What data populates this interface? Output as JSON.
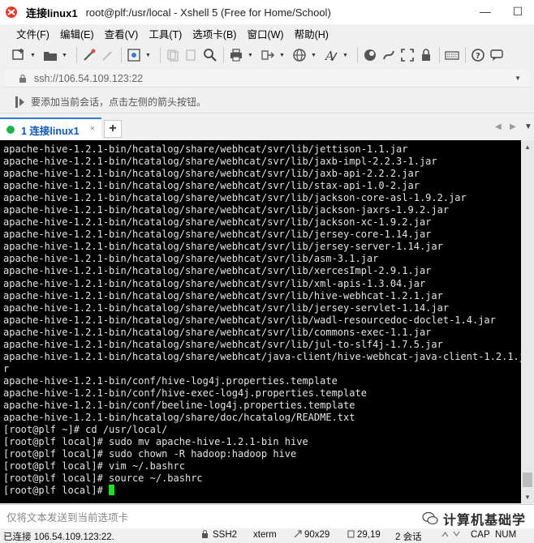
{
  "window": {
    "title_main": "连接linux1",
    "title_rest": "root@plf:/usr/local - Xshell 5 (Free for Home/School)",
    "min_glyph": "—",
    "max_glyph": "☐"
  },
  "menu": [
    "文件(F)",
    "编辑(E)",
    "查看(V)",
    "工具(T)",
    "选项卡(B)",
    "窗口(W)",
    "帮助(H)"
  ],
  "address": {
    "value": "ssh://106.54.109.123:22"
  },
  "hint": {
    "text": "要添加当前会话，点击左侧的箭头按钮。"
  },
  "tabs": [
    {
      "label": "1 连接linux1",
      "close": "×"
    }
  ],
  "tab_add": "+",
  "terminal": {
    "lines": [
      "apache-hive-1.2.1-bin/hcatalog/share/webhcat/svr/lib/jettison-1.1.jar",
      "apache-hive-1.2.1-bin/hcatalog/share/webhcat/svr/lib/jaxb-impl-2.2.3-1.jar",
      "apache-hive-1.2.1-bin/hcatalog/share/webhcat/svr/lib/jaxb-api-2.2.2.jar",
      "apache-hive-1.2.1-bin/hcatalog/share/webhcat/svr/lib/stax-api-1.0-2.jar",
      "apache-hive-1.2.1-bin/hcatalog/share/webhcat/svr/lib/jackson-core-asl-1.9.2.jar",
      "apache-hive-1.2.1-bin/hcatalog/share/webhcat/svr/lib/jackson-jaxrs-1.9.2.jar",
      "apache-hive-1.2.1-bin/hcatalog/share/webhcat/svr/lib/jackson-xc-1.9.2.jar",
      "apache-hive-1.2.1-bin/hcatalog/share/webhcat/svr/lib/jersey-core-1.14.jar",
      "apache-hive-1.2.1-bin/hcatalog/share/webhcat/svr/lib/jersey-server-1.14.jar",
      "apache-hive-1.2.1-bin/hcatalog/share/webhcat/svr/lib/asm-3.1.jar",
      "apache-hive-1.2.1-bin/hcatalog/share/webhcat/svr/lib/xercesImpl-2.9.1.jar",
      "apache-hive-1.2.1-bin/hcatalog/share/webhcat/svr/lib/xml-apis-1.3.04.jar",
      "apache-hive-1.2.1-bin/hcatalog/share/webhcat/svr/lib/hive-webhcat-1.2.1.jar",
      "apache-hive-1.2.1-bin/hcatalog/share/webhcat/svr/lib/jersey-servlet-1.14.jar",
      "apache-hive-1.2.1-bin/hcatalog/share/webhcat/svr/lib/wadl-resourcedoc-doclet-1.4.jar",
      "apache-hive-1.2.1-bin/hcatalog/share/webhcat/svr/lib/commons-exec-1.1.jar",
      "apache-hive-1.2.1-bin/hcatalog/share/webhcat/svr/lib/jul-to-slf4j-1.7.5.jar",
      "apache-hive-1.2.1-bin/hcatalog/share/webhcat/java-client/hive-webhcat-java-client-1.2.1.ja",
      "r",
      "apache-hive-1.2.1-bin/conf/hive-log4j.properties.template",
      "apache-hive-1.2.1-bin/conf/hive-exec-log4j.properties.template",
      "apache-hive-1.2.1-bin/conf/beeline-log4j.properties.template",
      "apache-hive-1.2.1-bin/hcatalog/share/doc/hcatalog/README.txt",
      "[root@plf ~]# cd /usr/local/",
      "[root@plf local]# sudo mv apache-hive-1.2.1-bin hive",
      "[root@plf local]# sudo chown -R hadoop:hadoop hive",
      "[root@plf local]# vim ~/.bashrc",
      "[root@plf local]# source ~/.bashrc"
    ],
    "prompt": "[root@plf local]# ",
    "cursor_color": "#1ee01e"
  },
  "input": {
    "placeholder": "仅将文本发送到当前选项卡"
  },
  "watermark": {
    "text": "计算机基础学"
  },
  "status": {
    "connection": "已连接 106.54.109.123:22.",
    "protocol": "SSH2",
    "term": "xterm",
    "size": "90x29",
    "position": "29,19",
    "sessions": "2 会话",
    "cap": "CAP",
    "num": "NUM"
  }
}
